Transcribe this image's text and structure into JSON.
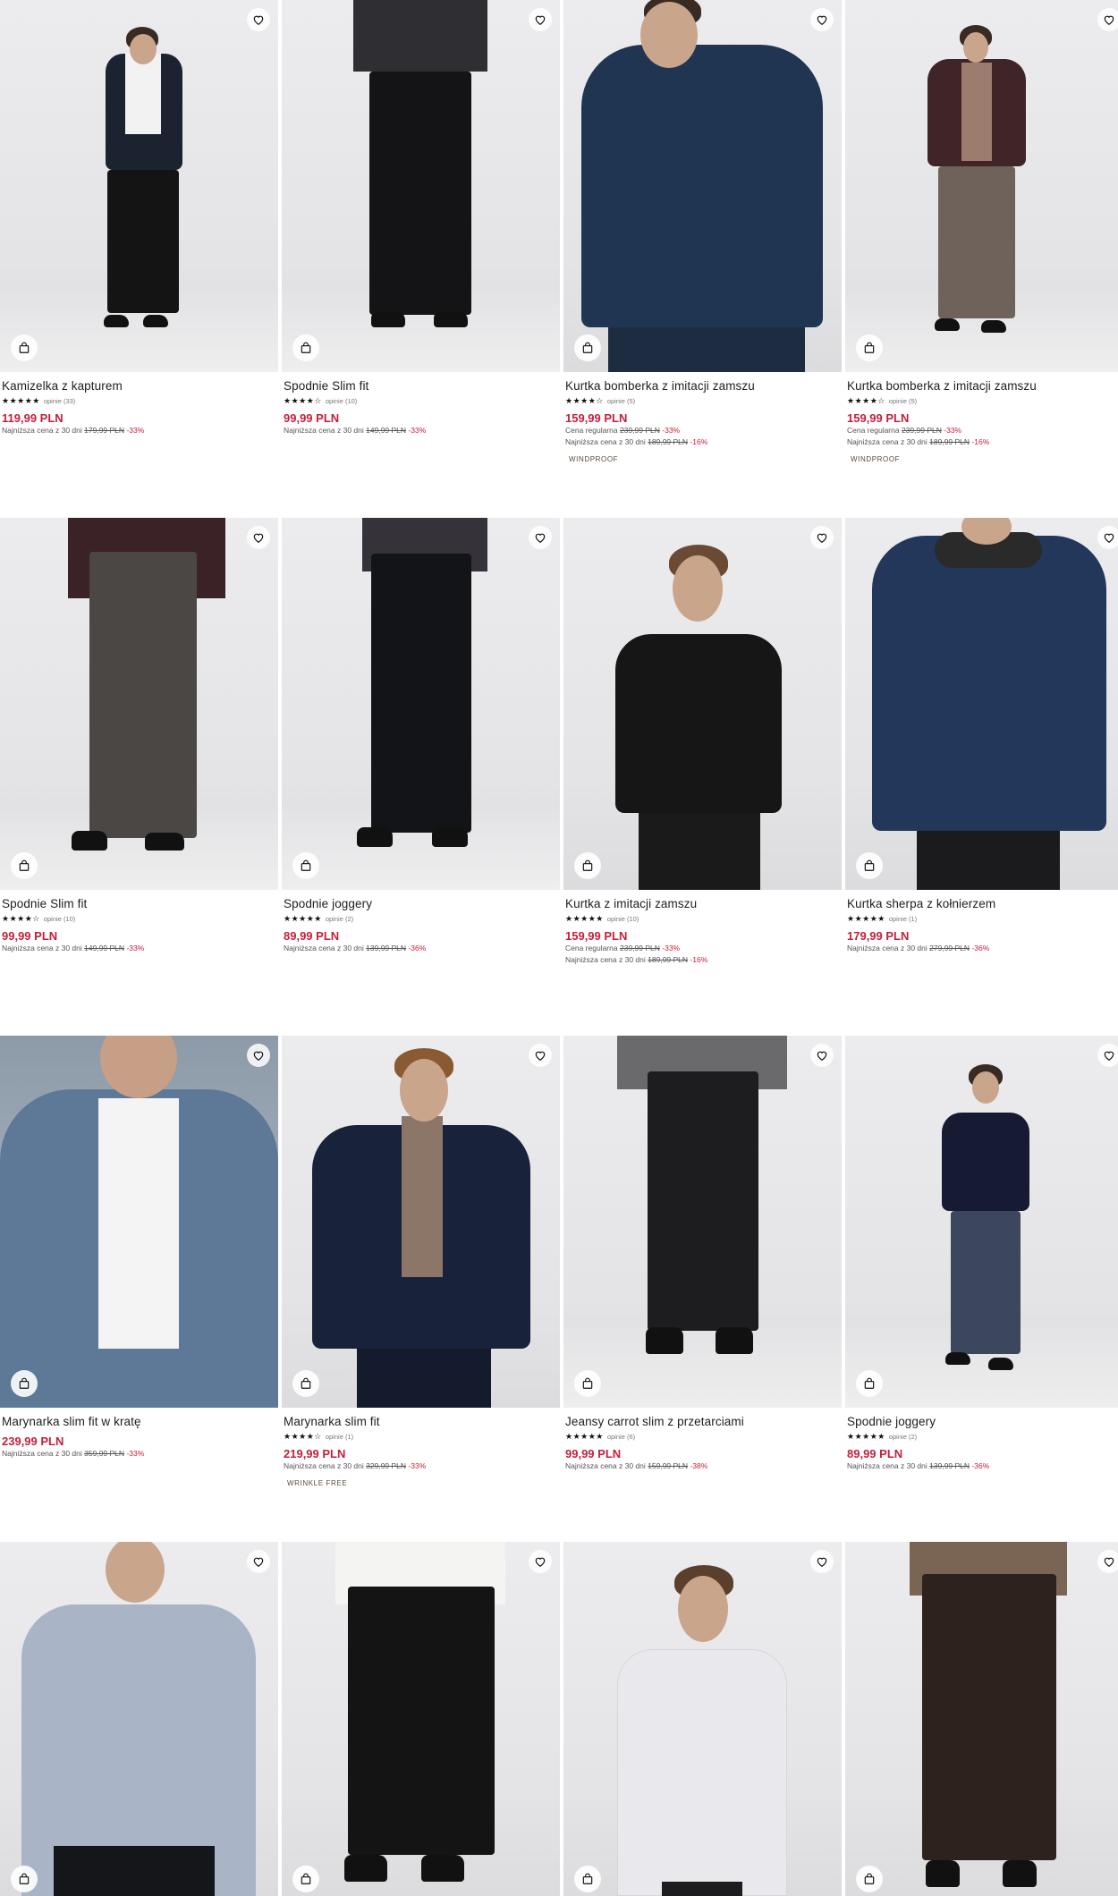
{
  "colors": {
    "price": "#c4203b",
    "text": "#1e1e1e",
    "muted": "#555555"
  },
  "icons": {
    "favorite": "heart-icon",
    "cart": "shopping-bag-icon"
  },
  "products": [
    {
      "title": "Kamizelka z kapturem",
      "stars": "★★★★★",
      "reviews": "opinie (33)",
      "price": "119,99 PLN",
      "regular_label": "",
      "regular_old": "",
      "regular_disc": "",
      "lowest_label": "Najniższa cena z 30 dni",
      "lowest_old": "179,99 PLN",
      "lowest_disc": "-33%",
      "tag": ""
    },
    {
      "title": "Spodnie Slim fit",
      "stars": "★★★★☆",
      "reviews": "opinie (10)",
      "price": "99,99 PLN",
      "regular_label": "",
      "regular_old": "",
      "regular_disc": "",
      "lowest_label": "Najniższa cena z 30 dni",
      "lowest_old": "149,99 PLN",
      "lowest_disc": "-33%",
      "tag": ""
    },
    {
      "title": "Kurtka bomberka z imitacji zamszu",
      "stars": "★★★★☆",
      "reviews": "opinie (5)",
      "price": "159,99 PLN",
      "regular_label": "Cena regularna",
      "regular_old": "239,99 PLN",
      "regular_disc": "-33%",
      "lowest_label": "Najniższa cena z 30 dni",
      "lowest_old": "189,99 PLN",
      "lowest_disc": "-16%",
      "tag": "WINDPROOF"
    },
    {
      "title": "Kurtka bomberka z imitacji zamszu",
      "stars": "★★★★☆",
      "reviews": "opinie (5)",
      "price": "159,99 PLN",
      "regular_label": "Cena regularna",
      "regular_old": "239,99 PLN",
      "regular_disc": "-33%",
      "lowest_label": "Najniższa cena z 30 dni",
      "lowest_old": "189,99 PLN",
      "lowest_disc": "-16%",
      "tag": "WINDPROOF"
    },
    {
      "title": "Spodnie Slim fit",
      "stars": "★★★★☆",
      "reviews": "opinie (10)",
      "price": "99,99 PLN",
      "regular_label": "",
      "regular_old": "",
      "regular_disc": "",
      "lowest_label": "Najniższa cena z 30 dni",
      "lowest_old": "149,99 PLN",
      "lowest_disc": "-33%",
      "tag": ""
    },
    {
      "title": "Spodnie joggery",
      "stars": "★★★★★",
      "reviews": "opinie (2)",
      "price": "89,99 PLN",
      "regular_label": "",
      "regular_old": "",
      "regular_disc": "",
      "lowest_label": "Najniższa cena z 30 dni",
      "lowest_old": "139,99 PLN",
      "lowest_disc": "-36%",
      "tag": ""
    },
    {
      "title": "Kurtka z imitacji zamszu",
      "stars": "★★★★★",
      "reviews": "opinie (10)",
      "price": "159,99 PLN",
      "regular_label": "Cena regularna",
      "regular_old": "239,99 PLN",
      "regular_disc": "-33%",
      "lowest_label": "Najniższa cena z 30 dni",
      "lowest_old": "189,99 PLN",
      "lowest_disc": "-16%",
      "tag": ""
    },
    {
      "title": "Kurtka sherpa z kołnierzem",
      "stars": "★★★★★",
      "reviews": "opinie (1)",
      "price": "179,99 PLN",
      "regular_label": "",
      "regular_old": "",
      "regular_disc": "",
      "lowest_label": "Najniższa cena z 30 dni",
      "lowest_old": "279,99 PLN",
      "lowest_disc": "-36%",
      "tag": ""
    },
    {
      "title": "Marynarka slim fit w kratę",
      "stars": "",
      "reviews": "",
      "price": "239,99 PLN",
      "regular_label": "",
      "regular_old": "",
      "regular_disc": "",
      "lowest_label": "Najniższa cena z 30 dni",
      "lowest_old": "359,99 PLN",
      "lowest_disc": "-33%",
      "tag": ""
    },
    {
      "title": "Marynarka slim fit",
      "stars": "★★★★☆",
      "reviews": "opinie (1)",
      "price": "219,99 PLN",
      "regular_label": "",
      "regular_old": "",
      "regular_disc": "",
      "lowest_label": "Najniższa cena z 30 dni",
      "lowest_old": "329,99 PLN",
      "lowest_disc": "-33%",
      "tag": "WRINKLE FREE"
    },
    {
      "title": "Jeansy carrot slim z przetarciami",
      "stars": "★★★★★",
      "reviews": "opinie (6)",
      "price": "99,99 PLN",
      "regular_label": "",
      "regular_old": "",
      "regular_disc": "",
      "lowest_label": "Najniższa cena z 30 dni",
      "lowest_old": "159,99 PLN",
      "lowest_disc": "-38%",
      "tag": ""
    },
    {
      "title": "Spodnie joggery",
      "stars": "★★★★★",
      "reviews": "opinie (2)",
      "price": "89,99 PLN",
      "regular_label": "",
      "regular_old": "",
      "regular_disc": "",
      "lowest_label": "Najniższa cena z 30 dni",
      "lowest_old": "139,99 PLN",
      "lowest_disc": "-36%",
      "tag": ""
    }
  ]
}
